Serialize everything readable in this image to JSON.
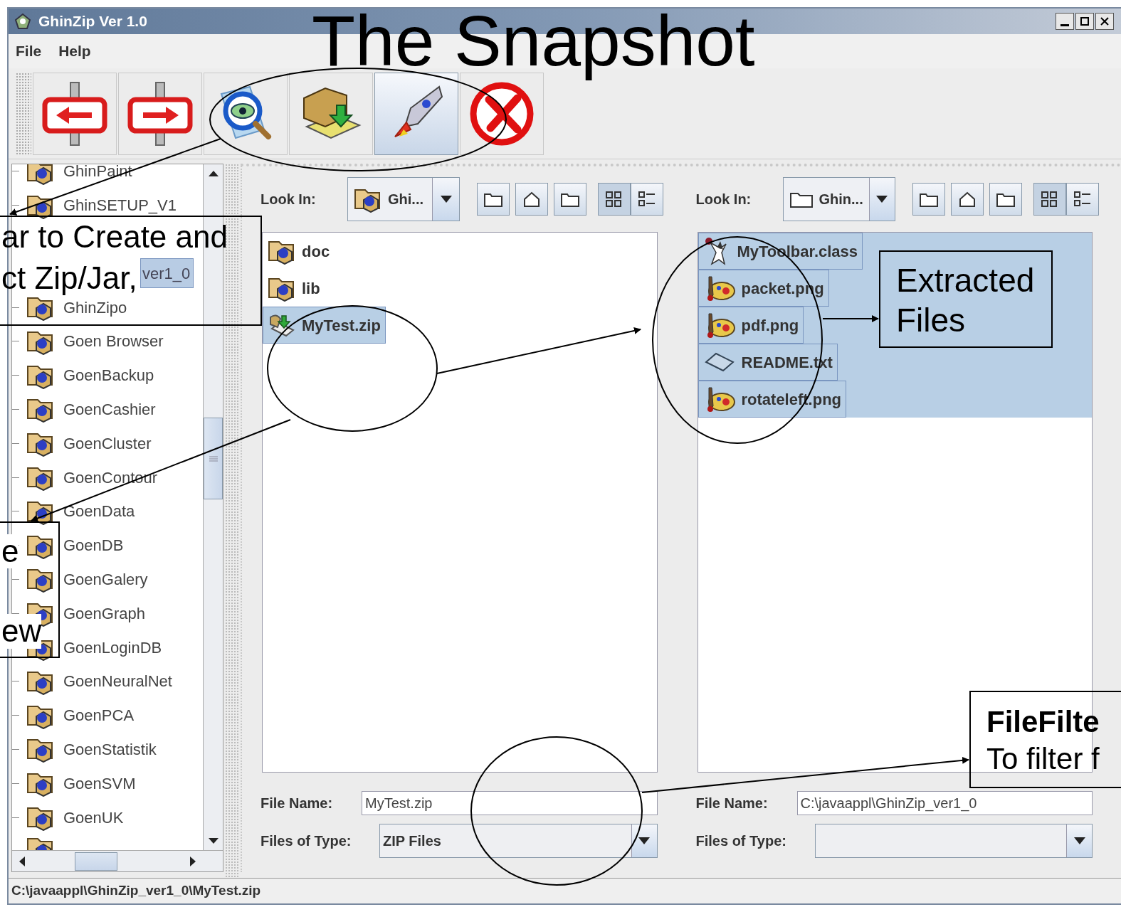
{
  "slide_title": "The Snapshot",
  "window": {
    "title": "GhinZip Ver 1.0"
  },
  "menu": [
    {
      "label": "File"
    },
    {
      "label": "Help"
    }
  ],
  "toolbar": [
    {
      "kind": "back",
      "hovered": false
    },
    {
      "kind": "forward",
      "hovered": false
    },
    {
      "kind": "view",
      "hovered": false
    },
    {
      "kind": "extract",
      "hovered": false
    },
    {
      "kind": "create",
      "hovered": true
    },
    {
      "kind": "exit",
      "hovered": false
    }
  ],
  "tree": [
    {
      "kind": "folder",
      "label": "GhinPaint",
      "selected": false
    },
    {
      "kind": "folder",
      "label": "GhinSETUP_V1",
      "selected": false
    },
    {
      "kind": "covered"
    },
    {
      "kind": "overlaid",
      "label": "ver1_0",
      "selected": true
    },
    {
      "kind": "folder",
      "label": "GhinZipo",
      "selected": false
    },
    {
      "kind": "folder",
      "label": "Goen Browser",
      "selected": false
    },
    {
      "kind": "folder",
      "label": "GoenBackup",
      "selected": false
    },
    {
      "kind": "folder",
      "label": "GoenCashier",
      "selected": false
    },
    {
      "kind": "folder",
      "label": "GoenCluster",
      "selected": false
    },
    {
      "kind": "folder",
      "label": "GoenContour",
      "selected": false
    },
    {
      "kind": "folder",
      "label": "GoenData",
      "selected": false
    },
    {
      "kind": "folder",
      "label": "GoenDB",
      "selected": false
    },
    {
      "kind": "folder",
      "label": "GoenGalery",
      "selected": false
    },
    {
      "kind": "folder",
      "label": "GoenGraph",
      "selected": false
    },
    {
      "kind": "folder",
      "label": "GoenLoginDB",
      "selected": false
    },
    {
      "kind": "folder",
      "label": "GoenNeuralNet",
      "selected": false
    },
    {
      "kind": "folder",
      "label": "GoenPCA",
      "selected": false
    },
    {
      "kind": "folder",
      "label": "GoenStatistik",
      "selected": false
    },
    {
      "kind": "folder",
      "label": "GoenSVM",
      "selected": false
    },
    {
      "kind": "folder",
      "label": "GoenUK",
      "selected": false
    },
    {
      "kind": "cut"
    }
  ],
  "choosers": [
    {
      "look_in_label": "Look In:",
      "look_in": {
        "text": "Ghi...",
        "kind": "package"
      },
      "files": [
        {
          "name": "doc",
          "kind": "package",
          "selected": false
        },
        {
          "name": "lib",
          "kind": "package",
          "selected": false
        },
        {
          "name": "MyTest.zip",
          "kind": "zip",
          "selected": true
        }
      ],
      "file_name_label": "File Name:",
      "file_name": "MyTest.zip",
      "type_label": "Files of Type:",
      "type": "ZIP Files"
    },
    {
      "look_in_label": "Look In:",
      "look_in": {
        "text": "Ghin...",
        "kind": "folder"
      },
      "files": [
        {
          "name": "MyToolbar.class",
          "kind": "class",
          "selected": true
        },
        {
          "name": "packet.png",
          "kind": "image",
          "selected": true
        },
        {
          "name": "pdf.png",
          "kind": "image",
          "selected": true
        },
        {
          "name": "README.txt",
          "kind": "text",
          "selected": true
        },
        {
          "name": "rotateleft.png",
          "kind": "image",
          "selected": true
        }
      ],
      "file_name_label": "File Name:",
      "file_name": "C:\\javaappl\\GhinZip_ver1_0",
      "type_label": "Files of Type:"
    }
  ],
  "status_bar": "C:\\javaappl\\GhinZip_ver1_0\\MyTest.zip",
  "callouts": [
    {
      "lines": [
        {
          "text": "ar to Create and",
          "bold": false
        },
        {
          "text": "ct Zip/Jar,",
          "bold": false
        }
      ]
    },
    {
      "lines": [
        {
          "text": "e",
          "bold": false
        },
        {
          "text": "ew",
          "bold": false
        }
      ]
    },
    {
      "lines": [
        {
          "text": "Extracted",
          "bold": false
        },
        {
          "text": "Files",
          "bold": false
        }
      ]
    },
    {
      "lines": [
        {
          "text": "FileFilte",
          "bold": true
        },
        {
          "text": "To filter f",
          "bold": false
        }
      ]
    }
  ]
}
